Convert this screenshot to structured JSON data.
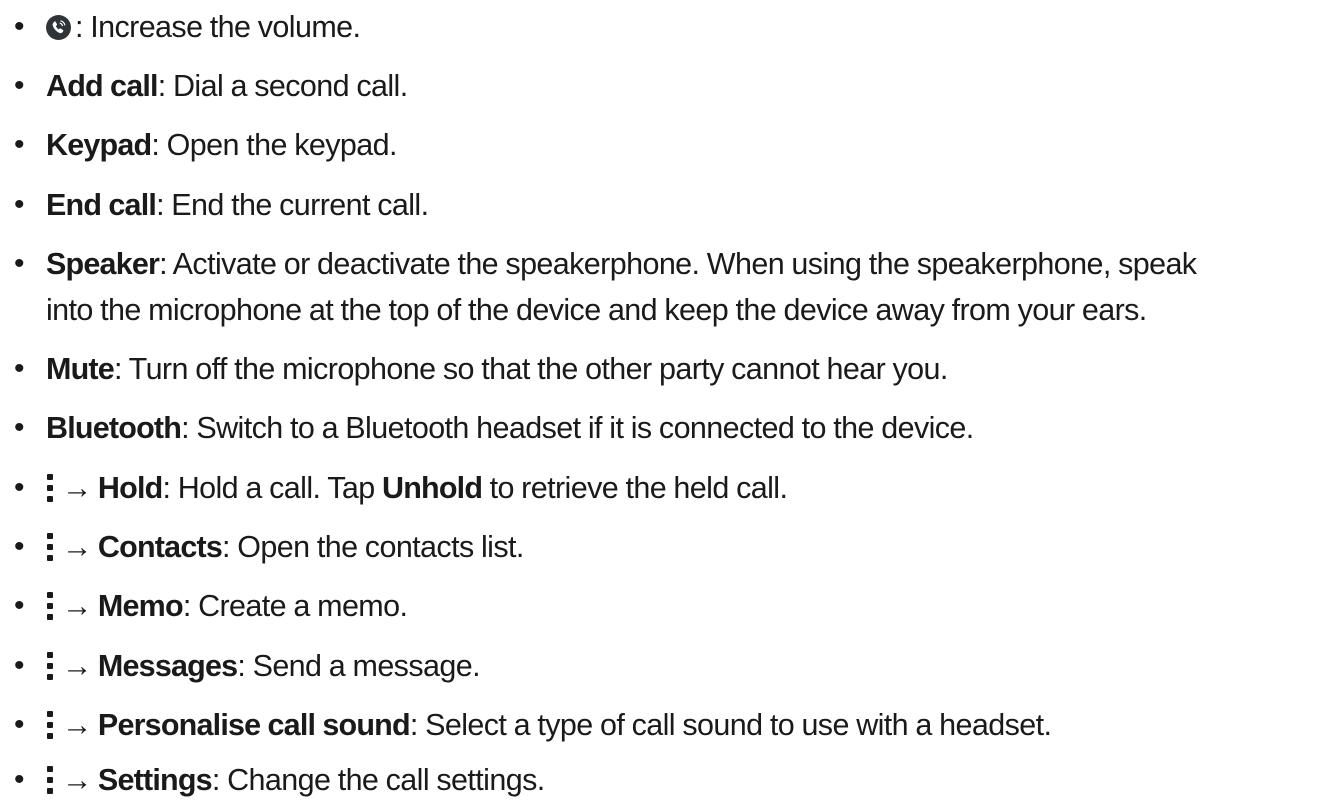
{
  "bullet_char": "•",
  "arrow_char": "→",
  "icons": {
    "volume": "volume-call-icon",
    "more": "more-options-icon"
  },
  "items": [
    {
      "desc": ": Increase the volume."
    },
    {
      "label": "Add call",
      "desc": ": Dial a second call."
    },
    {
      "label": "Keypad",
      "desc": ": Open the keypad."
    },
    {
      "label": "End call",
      "desc": ": End the current call."
    },
    {
      "label": "Speaker",
      "desc": ": Activate or deactivate the speakerphone. When using the speakerphone, speak",
      "desc_line2": "into the microphone at the top of the device and keep the device away from your ears."
    },
    {
      "label": "Mute",
      "desc": ": Turn off the microphone so that the other party cannot hear you."
    },
    {
      "label": "Bluetooth",
      "desc": ": Switch to a Bluetooth headset if it is connected to the device."
    },
    {
      "label": "Hold",
      "desc": ": Hold a call. Tap ",
      "label2": "Unhold",
      "desc2": " to retrieve the held call."
    },
    {
      "label": "Contacts",
      "desc": ": Open the contacts list."
    },
    {
      "label": "Memo",
      "desc": ": Create a memo."
    },
    {
      "label": "Messages",
      "desc": ": Send a message."
    },
    {
      "label": "Personalise call sound",
      "desc": ": Select a type of call sound to use with a headset."
    },
    {
      "label": "Settings",
      "desc": ": Change the call settings."
    }
  ]
}
